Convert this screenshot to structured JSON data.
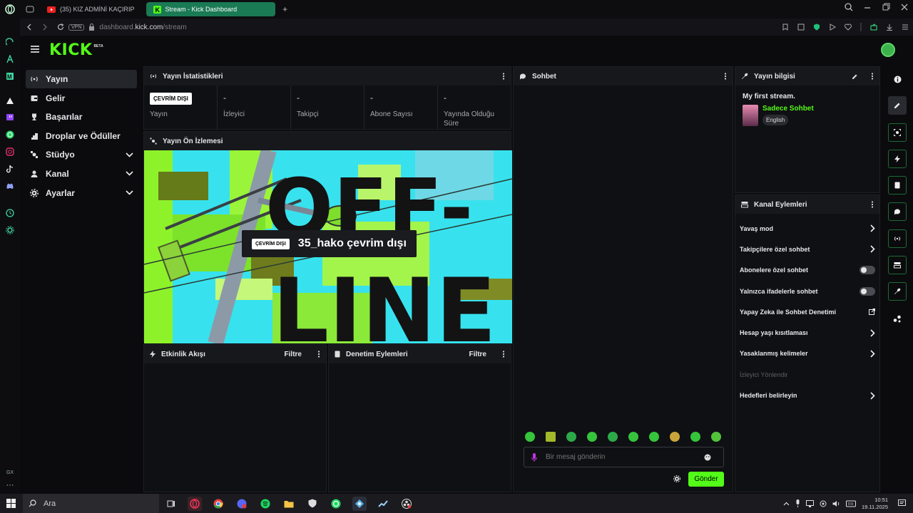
{
  "browser": {
    "tabs": [
      {
        "label": "(35) KIZ ADMİNİ KAÇIRIP",
        "icon": "youtube-icon"
      },
      {
        "label": "Stream - Kick Dashboard",
        "icon": "kick-icon",
        "active": true
      }
    ],
    "url_domain": "dashboard.",
    "url_host": "kick.com",
    "url_path": "/stream",
    "vpn_label": "VPN"
  },
  "app": {
    "logo_text": "KICK",
    "logo_badge": "BETA",
    "accent": "#53fc18"
  },
  "nav": [
    {
      "label": "Yayın",
      "icon": "broadcast-icon",
      "active": true
    },
    {
      "label": "Gelir",
      "icon": "wallet-icon"
    },
    {
      "label": "Başarılar",
      "icon": "trophy-icon"
    },
    {
      "label": "Droplar ve Ödüller",
      "icon": "gift-icon"
    },
    {
      "label": "Stüdyo",
      "icon": "studio-icon",
      "expandable": true
    },
    {
      "label": "Kanal",
      "icon": "user-icon",
      "expandable": true
    },
    {
      "label": "Ayarlar",
      "icon": "gear-icon",
      "expandable": true
    }
  ],
  "stats": {
    "title": "Yayın İstatistikleri",
    "status_badge": "ÇEVRİM DIŞI",
    "status_label": "Yayın",
    "items": [
      {
        "value": "-",
        "label": "İzleyici"
      },
      {
        "value": "-",
        "label": "Takipçi"
      },
      {
        "value": "-",
        "label": "Abone Sayısı"
      },
      {
        "value": "-",
        "label": "Yayında Olduğu Süre"
      }
    ]
  },
  "preview": {
    "title": "Yayın Ön İzlemesi",
    "badge": "ÇEVRİM DIŞI",
    "message": "35_hako çevrim dışı",
    "art_line1": "OFF-",
    "art_line2": "LINE"
  },
  "events": {
    "title": "Etkinlik Akışı",
    "filter": "Filtre"
  },
  "moderation": {
    "title": "Denetim Eylemleri",
    "filter": "Filtre"
  },
  "chat": {
    "title": "Sohbet",
    "placeholder": "Bir mesaj gönderin",
    "send": "Gönder"
  },
  "stream_info": {
    "title": "Yayın bilgisi",
    "stream_title": "My first stream.",
    "category": "Sadece Sohbet",
    "language": "English"
  },
  "channel_actions": {
    "title": "Kanal Eylemleri",
    "items": [
      {
        "label": "Yavaş mod",
        "control": "chevron"
      },
      {
        "label": "Takipçilere özel sohbet",
        "control": "chevron"
      },
      {
        "label": "Abonelere özel sohbet",
        "control": "toggle"
      },
      {
        "label": "Yalnızca ifadelerle sohbet",
        "control": "toggle"
      },
      {
        "label": "Yapay Zeka ile Sohbet Denetimi",
        "control": "external"
      },
      {
        "label": "Hesap yaşı kısıtlaması",
        "control": "chevron"
      },
      {
        "label": "Yasaklanmış kelimeler",
        "control": "chevron"
      },
      {
        "label": "İzleyici Yönlendir",
        "control": "none",
        "disabled": true
      },
      {
        "label": "Hedefleri belirleyin",
        "control": "chevron"
      }
    ]
  },
  "taskbar": {
    "search_placeholder": "Ara",
    "time": "10:51",
    "date": "19.11.2025"
  }
}
